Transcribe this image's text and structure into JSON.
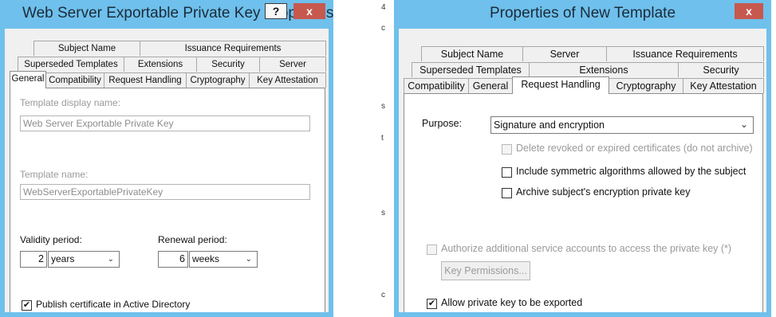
{
  "left_window": {
    "title": "Web Server Exportable Private Key Properties",
    "help_label": "?",
    "close_label": "x",
    "tabs_row1": [
      "Subject Name",
      "Issuance Requirements"
    ],
    "tabs_row2": [
      "Superseded Templates",
      "Extensions",
      "Security",
      "Server"
    ],
    "tabs_row3": [
      "General",
      "Compatibility",
      "Request Handling",
      "Cryptography",
      "Key Attestation"
    ],
    "active_tab": "General",
    "display_name_label": "Template display name:",
    "display_name_value": "Web Server Exportable Private Key",
    "template_name_label": "Template name:",
    "template_name_value": "WebServerExportablePrivateKey",
    "validity_label": "Validity period:",
    "validity_value": "2",
    "validity_unit": "years",
    "renewal_label": "Renewal period:",
    "renewal_value": "6",
    "renewal_unit": "weeks",
    "publish_label": "Publish certificate in Active Directory",
    "publish_checked": true
  },
  "right_window": {
    "title": "Properties of New Template",
    "close_label": "x",
    "tabs_row1": [
      "Subject Name",
      "Server",
      "Issuance Requirements"
    ],
    "tabs_row2": [
      "Superseded Templates",
      "Extensions",
      "Security"
    ],
    "tabs_row3": [
      "Compatibility",
      "General",
      "Request Handling",
      "Cryptography",
      "Key Attestation"
    ],
    "active_tab": "Request Handling",
    "purpose_label": "Purpose:",
    "purpose_value": "Signature and encryption",
    "delete_revoked_label": "Delete revoked or expired certificates (do not archive)",
    "include_symmetric_label": "Include symmetric algorithms allowed by the subject",
    "archive_label": "Archive subject's encryption private key",
    "authorize_label": "Authorize additional service accounts to access the private key (*)",
    "key_permissions_label": "Key Permissions...",
    "allow_export_label": "Allow private key to be exported",
    "allow_export_checked": true
  },
  "colors": {
    "titlebar": "#6fc0ec",
    "close_button": "#c7584e",
    "dialog_bg": "#f0f0f0",
    "panel_bg": "#ffffff"
  }
}
